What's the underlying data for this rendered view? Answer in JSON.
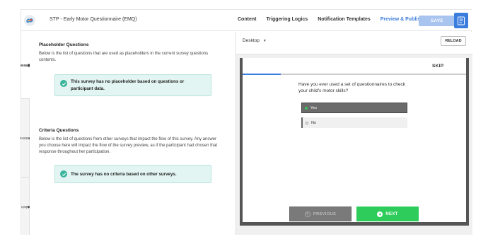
{
  "app": {
    "title": "STP - Early Motor Questionnaire (EMQ)",
    "logo_icon": "brand-logo-icon"
  },
  "nav": {
    "items": [
      {
        "label": "Content",
        "active": false
      },
      {
        "label": "Triggering Logics",
        "active": false
      },
      {
        "label": "Notification Templates",
        "active": false
      },
      {
        "label": "Preview & Publish",
        "active": true
      }
    ],
    "save_label": "SAVE",
    "doc_icon": "document-icon"
  },
  "rail": {
    "tabs": [
      {
        "label": "Preview",
        "icon": "eye-icon"
      },
      {
        "label": "Versions",
        "icon": "history-icon"
      },
      {
        "label": "Publish",
        "icon": "publish-icon"
      }
    ]
  },
  "placeholder": {
    "title": "Placeholder Questions",
    "description": "Below is the list of questions that are used as placeholders in the current survey questions contents.",
    "notice": "This survey has no placeholder based on questions or participant data."
  },
  "criteria": {
    "title": "Criteria Questions",
    "description": "Below is the list of questions from other surveys that impact the flow of this survey. Any answer you choose here will impact the flow of the survey preview, as if the participant had chosen that response throughout her participation.",
    "notice": "The survey has no criteria based on other surveys."
  },
  "preview": {
    "device": "Desktop",
    "reload_label": "RELOAD",
    "skip_label": "SKIP",
    "progress": 0.17,
    "question": "Have you ever used a set of questionnaires to check your child's motor skills?",
    "options": [
      {
        "label": "Yes",
        "selected": true
      },
      {
        "label": "No",
        "selected": false
      }
    ],
    "previous_label": "PREVIOUS",
    "next_label": "NEXT"
  },
  "colors": {
    "accent": "#3b7ddd",
    "success": "#2ecc5a",
    "notice_bg": "#e2f5f2"
  }
}
